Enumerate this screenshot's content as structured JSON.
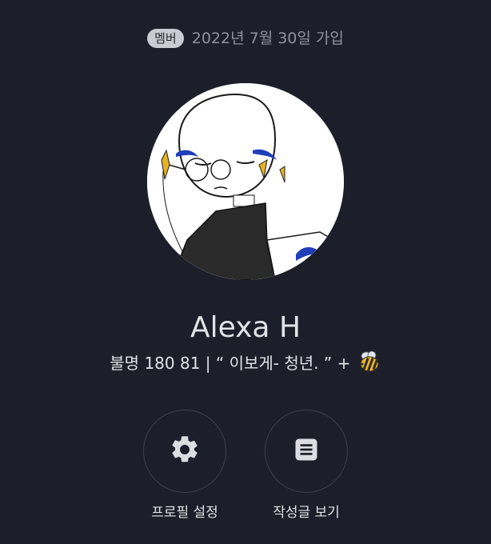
{
  "join_info": {
    "badge": "멤버",
    "date": "2022년 7월 30일 가입"
  },
  "profile": {
    "name": "Alexa H",
    "bio": "불명 180 81 | “ 이보게- 청년. ” + ",
    "bio_emoji": "bee-emoji"
  },
  "actions": {
    "settings": {
      "label": "프로필 설정",
      "icon": "gear-icon"
    },
    "posts": {
      "label": "작성글 보기",
      "icon": "document-icon"
    }
  },
  "colors": {
    "background": "#1c1f29",
    "badge_bg": "#c9cbd2",
    "muted_text": "#8e929e",
    "button_border": "#3b3f4b",
    "icon": "#dcdde3"
  }
}
